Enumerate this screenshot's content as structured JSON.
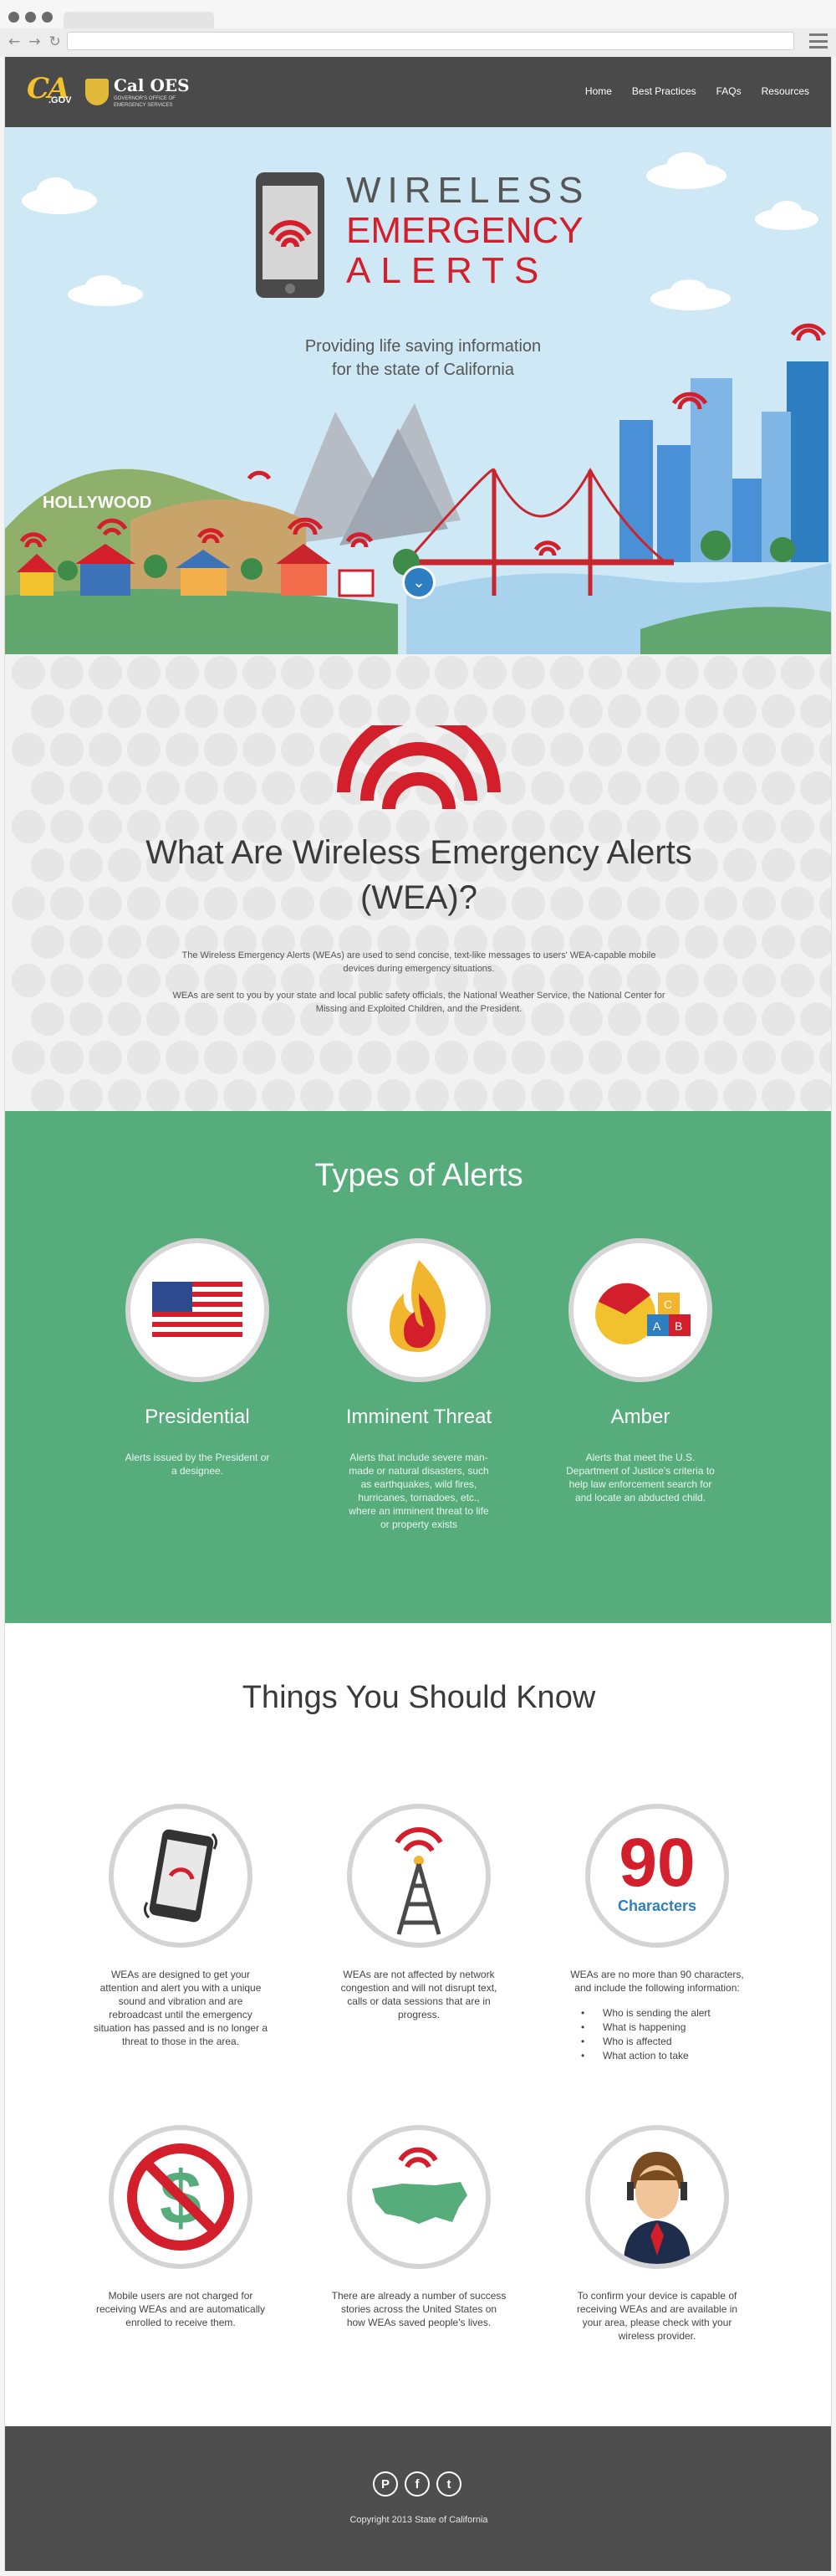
{
  "header": {
    "logo_ca": "CA",
    "logo_gov": ".GOV",
    "logo_oes": "Cal OES",
    "logo_sub": "GOVERNOR'S OFFICE OF EMERGENCY SERVICES",
    "nav": [
      "Home",
      "Best Practices",
      "FAQs",
      "Resources"
    ]
  },
  "hero": {
    "title_line1": "WIRELESS",
    "title_line2": "EMERGENCY",
    "title_line3": "ALERTS",
    "subtitle_line1": "Providing life saving information",
    "subtitle_line2": "for the state of California",
    "hollywood": "HOLLYWOOD"
  },
  "what": {
    "title_line1": "What Are Wireless Emergency Alerts",
    "title_line2": "(WEA)?",
    "para1": "The Wireless Emergency Alerts (WEAs) are used to send concise, text-like messages to users' WEA-capable mobile devices during emergency situations.",
    "para2": "WEAs are sent to you by your state and local public safety officials, the National Weather Service, the National Center for Missing and Exploited Children, and the President."
  },
  "types": {
    "title": "Types of Alerts",
    "items": [
      {
        "name": "Presidential",
        "desc": "Alerts issued by the President or a designee."
      },
      {
        "name": "Imminent Threat",
        "desc": "Alerts that include severe man-made or natural disasters, such as earthquakes, wild fires, hurricanes, tornadoes, etc., where an imminent threat to life or property exists"
      },
      {
        "name": "Amber",
        "desc": "Alerts that meet the U.S. Department of Justice's criteria to help law enforcement search for and locate an abducted child."
      }
    ]
  },
  "know": {
    "title": "Things You Should Know",
    "big_number": "90",
    "characters": "Characters",
    "items": [
      {
        "text": "WEAs are designed to get your attention and alert you with a unique sound and vibration and are rebroadcast until the emergency situation has passed and is no longer a threat to those in the area."
      },
      {
        "text": "WEAs are not affected by network congestion and will not disrupt text, calls or data sessions that are in progress."
      },
      {
        "text": "WEAs are no more than 90 characters, and include the following information:"
      },
      {
        "text": "Mobile users are not charged for receiving WEAs and are automatically enrolled to receive them."
      },
      {
        "text": "There are already a number of success stories across the United States on how WEAs saved people's lives."
      },
      {
        "text": "To confirm your device is capable of receiving WEAs and are available in your area, please check with your wireless provider."
      }
    ],
    "list": [
      "Who is sending the alert",
      "What is happening",
      "Who is affected",
      "What action to take"
    ]
  },
  "footer": {
    "social": [
      "P",
      "f",
      "t"
    ],
    "copyright": "Copyright 2013 State of California"
  },
  "colors": {
    "red": "#d21f2b",
    "green": "#57ac7c",
    "dark": "#4a4a4a",
    "sky": "#cfe8f5"
  }
}
